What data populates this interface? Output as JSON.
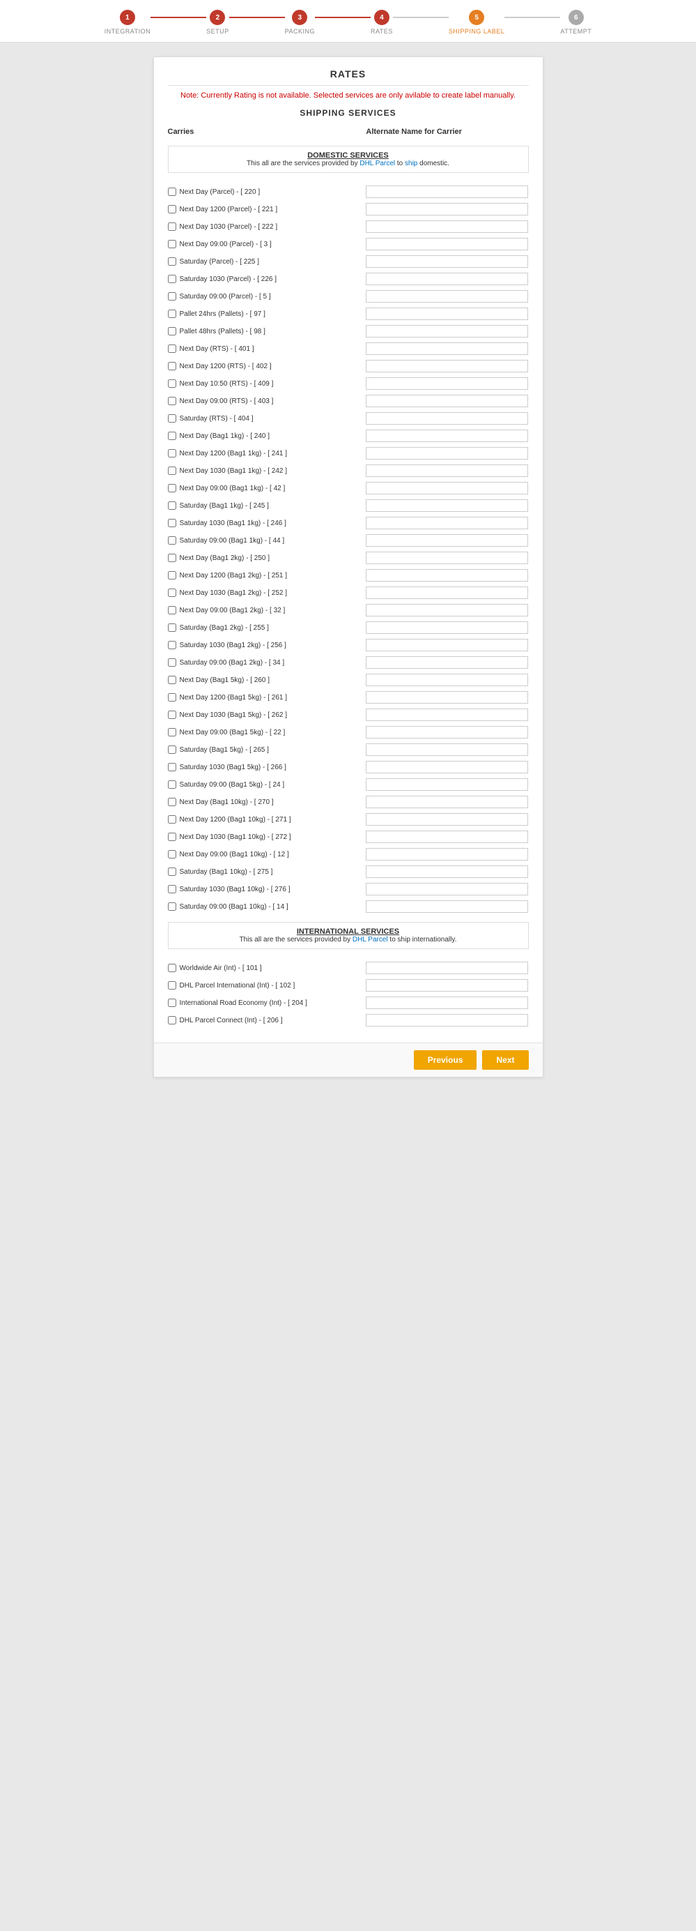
{
  "progress": {
    "steps": [
      {
        "label": "INTEGRATION",
        "number": "1",
        "state": "completed"
      },
      {
        "label": "SETUP",
        "number": "2",
        "state": "completed"
      },
      {
        "label": "PACKING",
        "number": "3",
        "state": "completed"
      },
      {
        "label": "RATES",
        "number": "4",
        "state": "completed"
      },
      {
        "label": "SHIPPING LABEL",
        "number": "5",
        "state": "active"
      },
      {
        "label": "ATTEMPT",
        "number": "6",
        "state": "inactive"
      }
    ]
  },
  "page": {
    "title": "RATES",
    "note": "Note: Currently Rating is not available. Selected services are only avilable to create label manually.",
    "section_title": "SHIPPING SERVICES",
    "col_carrier": "Carries",
    "col_alt": "Alternate Name for Carrier"
  },
  "domestic": {
    "group_title": "DOMESTIC SERVICES",
    "group_desc_pre": "This all are the services provided by ",
    "group_desc_brand": "DHL Parcel",
    "group_desc_mid": " to ",
    "group_desc_ship": "ship",
    "group_desc_post": " domestic.",
    "services": [
      "Next Day (Parcel) - [ 220 ]",
      "Next Day 1200 (Parcel) - [ 221 ]",
      "Next Day 1030 (Parcel) - [ 222 ]",
      "Next Day 09:00 (Parcel) - [ 3 ]",
      "Saturday (Parcel) - [ 225 ]",
      "Saturday 1030 (Parcel) - [ 226 ]",
      "Saturday 09:00 (Parcel) - [ 5 ]",
      "Pallet 24hrs (Pallets) - [ 97 ]",
      "Pallet 48hrs (Pallets) - [ 98 ]",
      "Next Day (RTS) - [ 401 ]",
      "Next Day 1200 (RTS) - [ 402 ]",
      "Next Day 10:50 (RTS) - [ 409 ]",
      "Next Day 09:00 (RTS) - [ 403 ]",
      "Saturday (RTS) - [ 404 ]",
      "Next Day (Bag1 1kg) - [ 240 ]",
      "Next Day 1200 (Bag1 1kg) - [ 241 ]",
      "Next Day 1030 (Bag1 1kg) - [ 242 ]",
      "Next Day 09:00 (Bag1 1kg) - [ 42 ]",
      "Saturday (Bag1 1kg) - [ 245 ]",
      "Saturday 1030 (Bag1 1kg) - [ 246 ]",
      "Saturday 09:00 (Bag1 1kg) - [ 44 ]",
      "Next Day (Bag1 2kg) - [ 250 ]",
      "Next Day 1200 (Bag1 2kg) - [ 251 ]",
      "Next Day 1030 (Bag1 2kg) - [ 252 ]",
      "Next Day 09:00 (Bag1 2kg) - [ 32 ]",
      "Saturday (Bag1 2kg) - [ 255 ]",
      "Saturday 1030 (Bag1 2kg) - [ 256 ]",
      "Saturday 09:00 (Bag1 2kg) - [ 34 ]",
      "Next Day (Bag1 5kg) - [ 260 ]",
      "Next Day 1200 (Bag1 5kg) - [ 261 ]",
      "Next Day 1030 (Bag1 5kg) - [ 262 ]",
      "Next Day 09:00 (Bag1 5kg) - [ 22 ]",
      "Saturday (Bag1 5kg) - [ 265 ]",
      "Saturday 1030 (Bag1 5kg) - [ 266 ]",
      "Saturday 09:00 (Bag1 5kg) - [ 24 ]",
      "Next Day (Bag1 10kg) - [ 270 ]",
      "Next Day 1200 (Bag1 10kg) - [ 271 ]",
      "Next Day 1030 (Bag1 10kg) - [ 272 ]",
      "Next Day 09:00 (Bag1 10kg) - [ 12 ]",
      "Saturday (Bag1 10kg) - [ 275 ]",
      "Saturday 1030 (Bag1 10kg) - [ 276 ]",
      "Saturday 09:00 (Bag1 10kg) - [ 14 ]"
    ]
  },
  "international": {
    "group_title": "INTERNATIONAL SERVICES",
    "group_desc_pre": "This all are the services provided by ",
    "group_desc_brand": "DHL Parcel",
    "group_desc_mid": " to ship internationally.",
    "services": [
      "Worldwide Air (Int) - [ 101 ]",
      "DHL Parcel International (Int) - [ 102 ]",
      "International Road Economy (Int) - [ 204 ]",
      "DHL Parcel Connect (Int) - [ 206 ]"
    ]
  },
  "buttons": {
    "previous": "Previous",
    "next": "Next"
  }
}
